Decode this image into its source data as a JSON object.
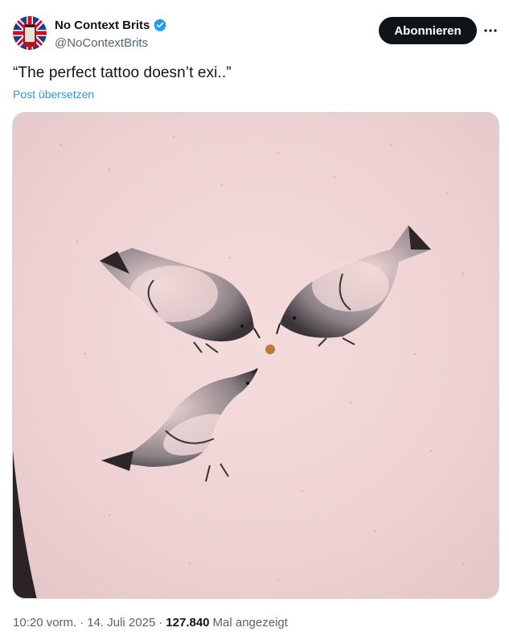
{
  "account": {
    "display_name": "No Context Brits",
    "handle": "@NoContextBrits",
    "verified": true,
    "avatar_icon": "union-jack-phone-box-avatar"
  },
  "actions": {
    "follow_label": "Abonnieren",
    "more_icon": "more-horizontal-icon"
  },
  "post": {
    "text": "“The perfect tattoo doesn’t exi..”",
    "translate_label": "Post übersetzen",
    "media_alt": "Tattoo of three pigeons pecking at a freckle"
  },
  "meta": {
    "time": "10:20 vorm.",
    "separator1": "·",
    "date": "14. Juli 2025",
    "separator2": "·",
    "views_count": "127.840",
    "views_label": "Mal angezeigt"
  },
  "colors": {
    "accent": "#1d9bf0",
    "text_primary": "#0f1419",
    "text_secondary": "#536471",
    "button_bg": "#0f1419"
  }
}
